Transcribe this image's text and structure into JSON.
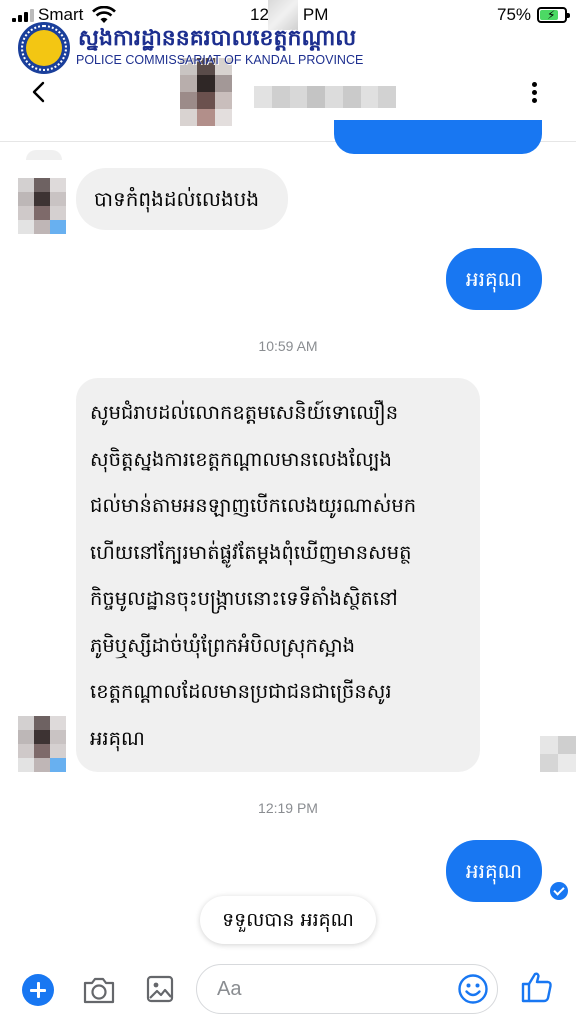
{
  "status_bar": {
    "carrier": "Smart",
    "time_prefix": "12",
    "time_suffix": "PM",
    "battery_percent": "75%",
    "battery_level": 0.75
  },
  "watermark": {
    "khmer_title": "ស្នងការដ្ឋាននគរបាលខេត្តកណ្ដាល",
    "english_title": "POLICE COMMISSARIAT OF KANDAL PROVINCE"
  },
  "header": {
    "back_icon": "chevron-left-icon",
    "menu_icon": "vertical-dots-icon"
  },
  "messages": [
    {
      "direction": "incoming",
      "text": "បាទកំពុងដល់លេងបង"
    },
    {
      "direction": "outgoing",
      "text": "អរគុណ"
    },
    {
      "type": "timestamp",
      "text": "10:59 AM"
    },
    {
      "direction": "incoming",
      "lines": [
        "សូមជំរាបដល់លោកឧត្តមសេនិយ៍ទោឈឿន",
        "សុចិត្តស្នងការខេត្តកណ្តាលមានលេងល្បែង",
        "ជល់មាន់តាមអនឡាញបើកលេងយូរណាស់មក",
        "ហើយនៅក្បែរមាត់ផ្លូវតែម្តងពុំឃើញមានសមត្ថ",
        "កិច្ចមូលដ្ឋានចុះបង្រ្កាបនោះទេទីតាំងស្ថិតនៅ",
        "ភូមិឬស្សីដាច់ឃុំព្រែកអំបិលស្រុកស្អាង",
        "ខេត្តកណ្តាលដែលមានប្រជាជនជាច្រើនសូរ",
        "អរគុណ"
      ]
    },
    {
      "type": "timestamp",
      "text": "12:19 PM"
    },
    {
      "direction": "outgoing",
      "text": "អរគុណ",
      "status": "sent"
    }
  ],
  "quick_reply": "ទទួលបាន អរគុណ",
  "composer": {
    "placeholder": "Aa",
    "icons": [
      "plus-icon",
      "camera-icon",
      "image-icon",
      "emoji-icon",
      "thumbs-up-icon"
    ]
  },
  "colors": {
    "messenger_blue": "#1877f2",
    "incoming_bubble": "#f0f0f0",
    "watermark_blue": "#1d2f8f",
    "timestamp_gray": "#8a8d91"
  }
}
